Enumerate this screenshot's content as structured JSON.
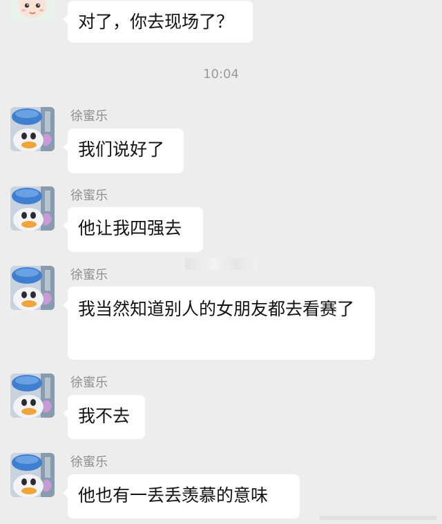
{
  "chat": {
    "timestamp": "10:04",
    "first_message": {
      "text": "对了，你去现场了？"
    },
    "messages": [
      {
        "sender": "徐蜜乐",
        "text": "我们说好了"
      },
      {
        "sender": "徐蜜乐",
        "text": "他让我四强去"
      },
      {
        "sender": "徐蜜乐",
        "text": "我当然知道别人的女朋友都去看赛了"
      },
      {
        "sender": "徐蜜乐",
        "text": "我不去"
      },
      {
        "sender": "徐蜜乐",
        "text": "他也有一丢丢羡慕的意味"
      }
    ]
  },
  "colors": {
    "chat_background": "#ededed",
    "bubble": "#ffffff",
    "sender_name": "#8e8e8e",
    "avatar_blue": "#3f7fd0"
  },
  "icons": {
    "top_avatar": "cartoon-avatar-icon",
    "sender_avatar": "duck-avatar-icon"
  }
}
